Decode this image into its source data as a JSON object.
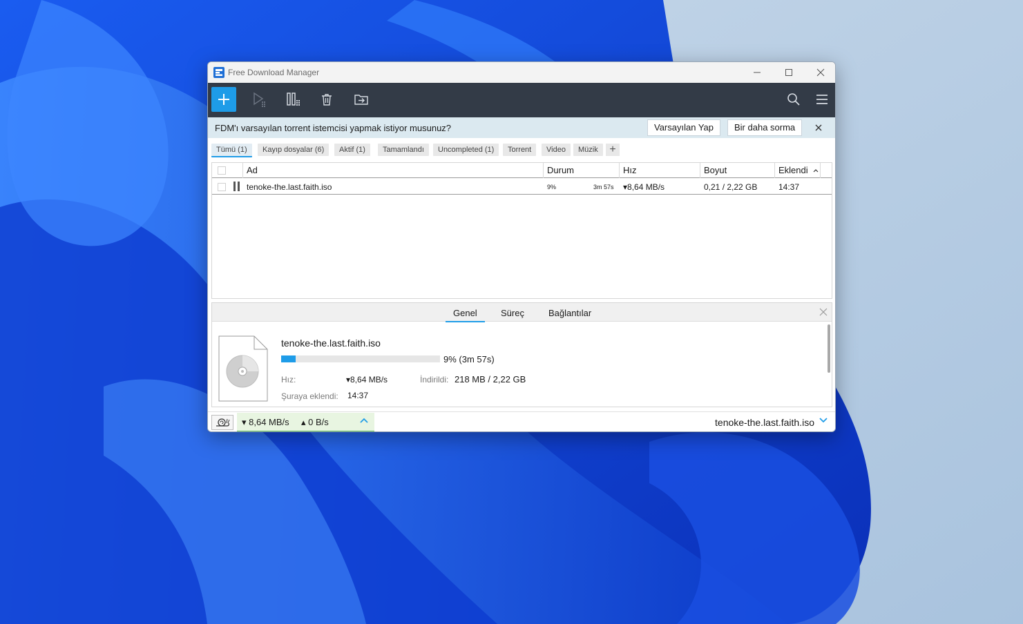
{
  "window": {
    "title": "Free Download Manager"
  },
  "notice": {
    "text": "FDM'ı varsayılan torrent istemcisi yapmak istiyor musunuz?",
    "btn_default": "Varsayılan Yap",
    "btn_never": "Bir daha sorma"
  },
  "filters": [
    {
      "label": "Tümü (1)",
      "active": true
    },
    {
      "label": "Kayıp dosyalar (6)",
      "active": false
    },
    {
      "label": "Aktif (1)",
      "active": false
    },
    {
      "label": "Tamamlandı",
      "active": false
    },
    {
      "label": "Uncompleted (1)",
      "active": false
    },
    {
      "label": "Torrent",
      "active": false
    },
    {
      "label": "Video",
      "active": false
    },
    {
      "label": "Müzik",
      "active": false
    }
  ],
  "filter_add": "+",
  "table": {
    "headers": {
      "name": "Ad",
      "status": "Durum",
      "speed": "Hız",
      "size": "Boyut",
      "added": "Eklendi"
    },
    "rows": [
      {
        "name": "tenoke-the.last.faith.iso",
        "percent": "9%",
        "eta": "3m 57s",
        "speed": "▾8,64 MB/s",
        "size": "0,21 / 2,22 GB",
        "added": "14:37"
      }
    ]
  },
  "details": {
    "tabs": [
      "Genel",
      "Süreç",
      "Bağlantılar"
    ],
    "active_tab": "Genel",
    "file_name": "tenoke-the.last.faith.iso",
    "progress_fraction": 0.09,
    "progress_text": "9%  (3m 57s)",
    "speed_label": "Hız:",
    "speed_value": "▾8,64 MB/s",
    "downloaded_label": "İndirildi:",
    "downloaded_value": "218 MB / 2,22 GB",
    "added_label": "Şuraya eklendi:",
    "added_value": "14:37"
  },
  "statusbar": {
    "down_speed": "▾ 8,64 MB/s",
    "up_speed": "▴ 0 B/s",
    "current_file": "tenoke-the.last.faith.iso"
  },
  "colors": {
    "accent": "#1e9ce8",
    "toolbar_bg": "#333b47",
    "notice_bg": "#dbe9f0",
    "speed_green": "#5cc05a"
  }
}
